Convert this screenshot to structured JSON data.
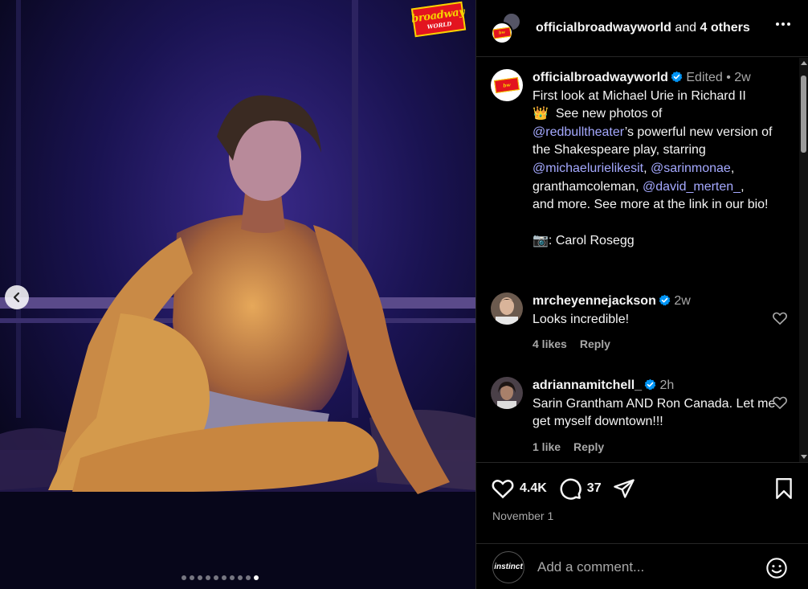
{
  "photo": {
    "logo_line1": "broadway",
    "logo_line2": "WORLD",
    "carousel_total": 10,
    "carousel_active": 10
  },
  "header": {
    "account": "officialbroadwayworld",
    "and_text": "and",
    "others": "4 others"
  },
  "caption": {
    "username": "officialbroadwayworld",
    "edited": "Edited",
    "bullet": "•",
    "age": "2w",
    "line1": "First look at Michael Urie in Richard II",
    "crown": "👑",
    "line2a": "See new photos of",
    "mention1": "@redbulltheater",
    "line3": "’s powerful new version of the Shakespeare play, starring",
    "mention2": "@michaelurielikesit",
    "comma1": ",",
    "mention3": "@sarinmonae",
    "comma2": ",",
    "line4": "granthamcoleman,",
    "mention4": "@david_merten_",
    "comma3": ",",
    "line5": "and more. See more at the link in our bio!",
    "camera": "📷",
    "credit": ": Carol Rosegg"
  },
  "comments": [
    {
      "username": "mrcheyennejackson",
      "age": "2w",
      "text": "Looks incredible!",
      "likes": "4 likes",
      "reply": "Reply"
    },
    {
      "username": "adriannamitchell_",
      "age": "2h",
      "text": "Sarin Grantham AND Ron Canada. Let me get myself downtown!!!",
      "likes": "1 like",
      "reply": "Reply"
    }
  ],
  "stats": {
    "likes": "4.4K",
    "comments": "37"
  },
  "date": "November 1",
  "add_comment": {
    "avatar_text": "instinct",
    "placeholder": "Add a comment..."
  },
  "colors": {
    "mention": "#a5a9ff",
    "verified": "#0095f6",
    "brand_red": "#e3141f",
    "brand_yellow": "#f6d400"
  }
}
